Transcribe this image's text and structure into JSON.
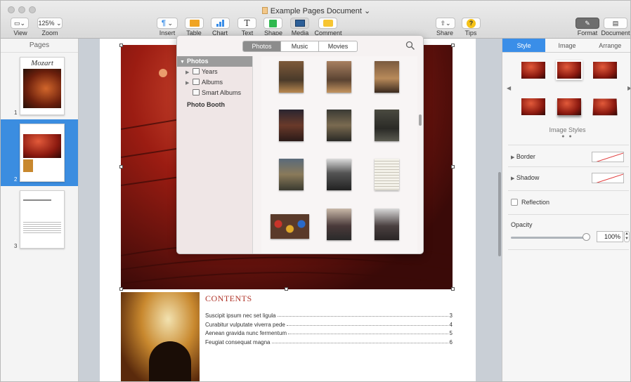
{
  "window": {
    "title": "Example Pages Document"
  },
  "toolbar": {
    "view_label": "View",
    "zoom_value": "125%",
    "zoom_label": "Zoom",
    "insert_label": "Insert",
    "table_label": "Table",
    "chart_label": "Chart",
    "text_label": "Text",
    "shape_label": "Shape",
    "media_label": "Media",
    "comment_label": "Comment",
    "share_label": "Share",
    "tips_label": "Tips",
    "format_label": "Format",
    "document_label": "Document",
    "icons": [
      "sidebar-icon",
      "paragraph-icon",
      "table-icon",
      "chart-icon",
      "text-icon",
      "shape-icon",
      "media-icon",
      "comment-icon",
      "share-icon",
      "tips-icon",
      "paintbrush-icon",
      "document-icon"
    ]
  },
  "sidebar": {
    "header": "Pages",
    "pages": [
      {
        "number": "1",
        "thumb_title": "Mozart"
      },
      {
        "number": "2"
      },
      {
        "number": "3"
      }
    ]
  },
  "document": {
    "contents_title": "CONTENTS",
    "toc": [
      {
        "text": "Suscipit ipsum nec set ligula",
        "page": "3"
      },
      {
        "text": "Curabitur vulputate viverra pede",
        "page": "4"
      },
      {
        "text": "Aenean gravida nunc fermentum",
        "page": "5"
      },
      {
        "text": "Feugiat consequat magna",
        "page": "6"
      }
    ]
  },
  "media_browser": {
    "tabs": [
      "Photos",
      "Music",
      "Movies"
    ],
    "active_tab": "Photos",
    "sources": [
      {
        "label": "Photos",
        "type": "header"
      },
      {
        "label": "Years",
        "type": "group"
      },
      {
        "label": "Albums",
        "type": "group"
      },
      {
        "label": "Smart Albums",
        "type": "item"
      },
      {
        "label": "Photo Booth",
        "type": "section"
      }
    ]
  },
  "inspector": {
    "tabs": [
      "Style",
      "Image",
      "Arrange"
    ],
    "active_tab": "Style",
    "styles_caption": "Image Styles",
    "border_label": "Border",
    "shadow_label": "Shadow",
    "reflection_label": "Reflection",
    "opacity_label": "Opacity",
    "opacity_value": "100%",
    "opacity_fraction": 1.0
  },
  "colors": {
    "accent": "#3a8ee8",
    "toc_title": "#b0352a",
    "selected_page": "#3b8de0"
  }
}
